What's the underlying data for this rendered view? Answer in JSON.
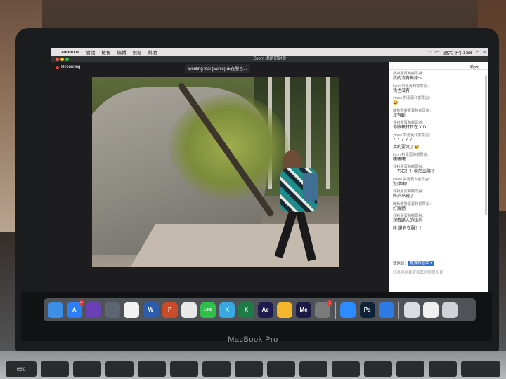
{
  "menubar": {
    "app": "zoom.us",
    "items": [
      "會議",
      "檢視",
      "編輯",
      "視窗",
      "幫助"
    ],
    "datetime": "週六 下午1:58"
  },
  "window": {
    "title": "Zoom 網路研討會",
    "recording_label": "Recording",
    "speaker_label": "wenting tsai (Eunie) 正在發言..."
  },
  "chat": {
    "header_title": "聊天",
    "messages": [
      {
        "from": "我對嘉賓和觀眾說：",
        "text": "我的沒有斷線～"
      },
      {
        "from": "Lynn 對嘉賓和觀眾說：",
        "text": "我也沒有"
      },
      {
        "from": "yiwen 對嘉賓和觀眾說：",
        "text": "😂"
      },
      {
        "from": "陳秋雅對嘉賓和觀眾說：",
        "text": "沒有斷"
      },
      {
        "from": "我對嘉賓和觀眾說：",
        "text": "你臉被打狂在ＸＤ"
      },
      {
        "from": "yiwen 對嘉賓和觀眾說：",
        "text": "？？？？？"
      },
      {
        "from": "",
        "text": "真的要哭了😂"
      },
      {
        "from": "Lynn 對嘉賓和觀眾說：",
        "text": "嘿嘿嘿"
      },
      {
        "from": "我對嘉賓和觀眾說：",
        "text": "一刀石！！中於出限了"
      },
      {
        "from": "yiwen 對嘉賓和觀眾說：",
        "text": "沒錯噢！"
      },
      {
        "from": "我對嘉賓和觀眾說：",
        "text": "終於出現了"
      },
      {
        "from": "陳秋雅對嘉賓和觀眾說：",
        "text": "好震撼"
      },
      {
        "from": "我對嘉賓和觀眾說：",
        "text": "想看路人的比例"
      },
      {
        "from": "",
        "text": "哇 還有衣服！！"
      }
    ],
    "send_to_label": "傳送到:",
    "send_to_value": "嘉賓和觀眾",
    "input_placeholder": "訊息可為嘉賓和其他觀眾所見"
  },
  "dock": {
    "icons": [
      {
        "name": "finder",
        "label": "",
        "color": "#3d8fe6"
      },
      {
        "name": "app-store",
        "label": "A",
        "color": "#2d7ff5",
        "badge": "4"
      },
      {
        "name": "siri",
        "label": "",
        "color": "#6b3fb5"
      },
      {
        "name": "launchpad",
        "label": "",
        "color": "#5d6570"
      },
      {
        "name": "photos",
        "label": "",
        "color": "#f2f2f2"
      },
      {
        "name": "word",
        "label": "W",
        "color": "#2b5cad"
      },
      {
        "name": "powerpoint",
        "label": "P",
        "color": "#c94b2a"
      },
      {
        "name": "chrome",
        "label": "",
        "color": "#e9e9e9"
      },
      {
        "name": "line",
        "label": "LINE",
        "color": "#2fbf4b"
      },
      {
        "name": "kite",
        "label": "K",
        "color": "#3aa8e0"
      },
      {
        "name": "excel",
        "label": "X",
        "color": "#1e7b45"
      },
      {
        "name": "after-effects",
        "label": "Ae",
        "color": "#1d1a4d"
      },
      {
        "name": "sketch",
        "label": "",
        "color": "#f5b52d"
      },
      {
        "name": "media-encoder",
        "label": "Me",
        "color": "#1a1a45"
      },
      {
        "name": "system-preferences",
        "label": "",
        "color": "#7a7a7a",
        "badge": "1"
      },
      {
        "name": "zoom",
        "label": "",
        "color": "#2d8cff"
      },
      {
        "name": "photoshop",
        "label": "Ps",
        "color": "#0e2436"
      },
      {
        "name": "keynote",
        "label": "",
        "color": "#2c7be5"
      },
      {
        "name": "preview-folder",
        "label": "",
        "color": "#d9dde3"
      },
      {
        "name": "document",
        "label": "",
        "color": "#efefef"
      },
      {
        "name": "trash",
        "label": "",
        "color": "#cfd2d6"
      }
    ]
  },
  "hardware": {
    "brand_label": "MacBook Pro",
    "esc_key": "esc"
  }
}
